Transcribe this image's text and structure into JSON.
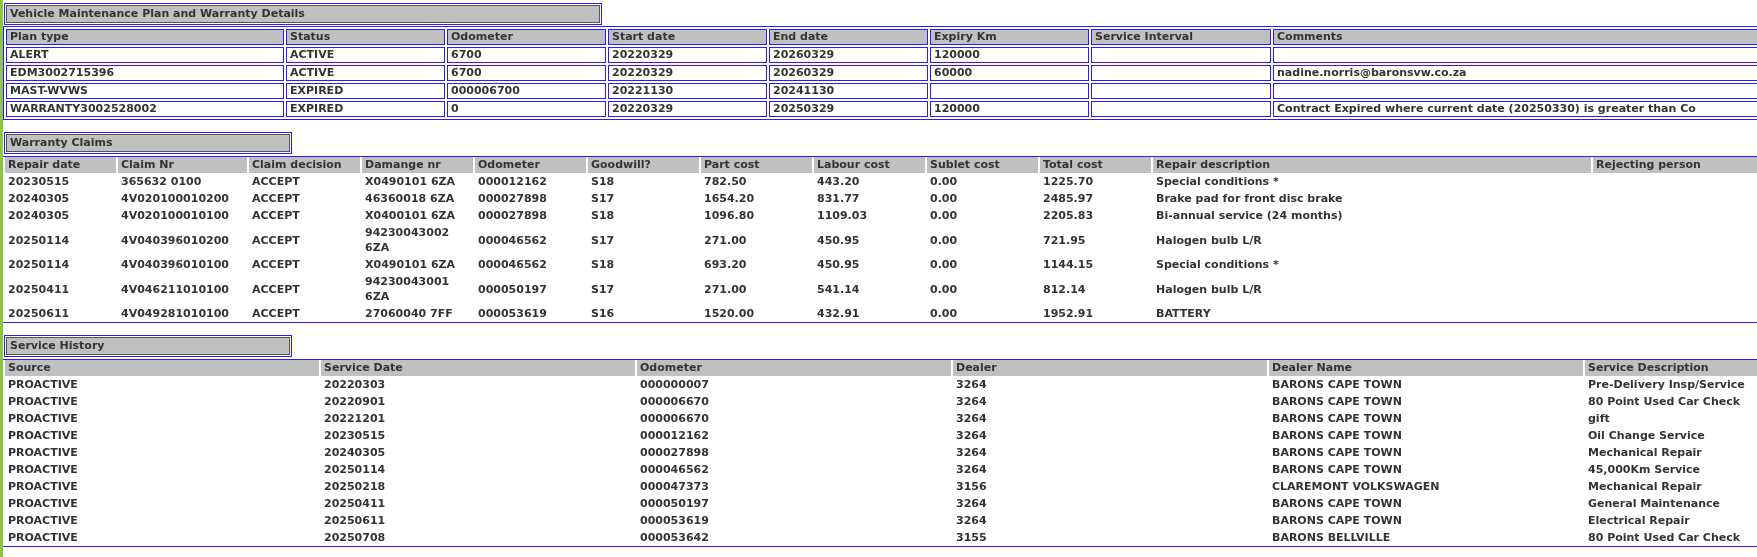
{
  "sections": [
    {
      "kind": "bordered",
      "title": "Vehicle Maintenance Plan and Warranty Details",
      "columns": [
        "Plan type",
        "Status",
        "Odometer",
        "Start date",
        "End date",
        "Expiry Km",
        "Service Interval",
        "Comments"
      ],
      "rows": [
        [
          "ALERT",
          "ACTIVE",
          "6700",
          "20220329",
          "20260329",
          "120000",
          null,
          null
        ],
        [
          "EDM3002715396",
          "ACTIVE",
          "6700",
          "20220329",
          "20260329",
          "60000",
          null,
          "nadine.norris@baronsvw.co.za"
        ],
        [
          "MAST-WVWS",
          "EXPIRED",
          "000006700",
          "20221130",
          "20241130",
          null,
          null,
          null
        ],
        [
          "WARRANTY3002528002",
          "EXPIRED",
          "0",
          "20220329",
          "20250329",
          "120000",
          null,
          "Contract Expired where current date (20250330) is greater than Co"
        ]
      ]
    },
    {
      "kind": "plain",
      "title": "Warranty Claims",
      "columns": [
        "Repair date",
        "Claim Nr",
        "Claim decision",
        "Damange nr",
        "Odometer",
        "Goodwill?",
        "Part cost",
        "Labour cost",
        "Sublet cost",
        "Total cost",
        "Repair description",
        "Rejecting person"
      ],
      "rows": [
        [
          "20230515",
          "365632 0100",
          "ACCEPT",
          "X0490101 6ZA",
          "000012162",
          "S18",
          "782.50",
          "443.20",
          "0.00",
          "1225.70",
          "Special conditions *",
          null
        ],
        [
          "20240305",
          "4V020100010200",
          "ACCEPT",
          "46360018 6ZA",
          "000027898",
          "S17",
          "1654.20",
          "831.77",
          "0.00",
          "2485.97",
          "Brake pad for front disc brake",
          null
        ],
        [
          "20240305",
          "4V020100010100",
          "ACCEPT",
          "X0400101 6ZA",
          "000027898",
          "S18",
          "1096.80",
          "1109.03",
          "0.00",
          "2205.83",
          "Bi-annual service (24 months)",
          null
        ],
        [
          "20250114",
          "4V040396010200",
          "ACCEPT",
          "94230043002 6ZA",
          "000046562",
          "S17",
          "271.00",
          "450.95",
          "0.00",
          "721.95",
          "Halogen bulb L/R",
          null
        ],
        [
          "20250114",
          "4V040396010100",
          "ACCEPT",
          "X0490101 6ZA",
          "000046562",
          "S18",
          "693.20",
          "450.95",
          "0.00",
          "1144.15",
          "Special conditions *",
          null
        ],
        [
          "20250411",
          "4V046211010100",
          "ACCEPT",
          "94230043001 6ZA",
          "000050197",
          "S17",
          "271.00",
          "541.14",
          "0.00",
          "812.14",
          "Halogen bulb L/R",
          null
        ],
        [
          "20250611",
          "4V049281010100",
          "ACCEPT",
          "27060040 7FF",
          "000053619",
          "S16",
          "1520.00",
          "432.91",
          "0.00",
          "1952.91",
          "BATTERY",
          null
        ]
      ]
    },
    {
      "kind": "plain",
      "title": "Service History",
      "columns": [
        "Source",
        "Service Date",
        "Odometer",
        "Dealer",
        "Dealer Name",
        "Service Description"
      ],
      "rows": [
        [
          "PROACTIVE",
          "20220303",
          "000000007",
          "3264",
          "BARONS CAPE TOWN",
          "Pre-Delivery Insp/Service"
        ],
        [
          "PROACTIVE",
          "20220901",
          "000006670",
          "3264",
          "BARONS CAPE TOWN",
          "80 Point Used Car Check"
        ],
        [
          "PROACTIVE",
          "20221201",
          "000006670",
          "3264",
          "BARONS CAPE TOWN",
          "gift"
        ],
        [
          "PROACTIVE",
          "20230515",
          "000012162",
          "3264",
          "BARONS CAPE TOWN",
          "Oil Change Service"
        ],
        [
          "PROACTIVE",
          "20240305",
          "000027898",
          "3264",
          "BARONS CAPE TOWN",
          "Mechanical Repair"
        ],
        [
          "PROACTIVE",
          "20250114",
          "000046562",
          "3264",
          "BARONS CAPE TOWN",
          "45,000Km Service"
        ],
        [
          "PROACTIVE",
          "20250218",
          "000047373",
          "3156",
          "CLAREMONT VOLKSWAGEN",
          "Mechanical Repair"
        ],
        [
          "PROACTIVE",
          "20250411",
          "000050197",
          "3264",
          "BARONS CAPE TOWN",
          "General Maintenance"
        ],
        [
          "PROACTIVE",
          "20250611",
          "000053619",
          "3264",
          "BARONS CAPE TOWN",
          "Electrical Repair"
        ],
        [
          "PROACTIVE",
          "20250708",
          "000053642",
          "3155",
          "BARONS BELLVILLE",
          "80 Point Used Car Check"
        ]
      ]
    }
  ]
}
